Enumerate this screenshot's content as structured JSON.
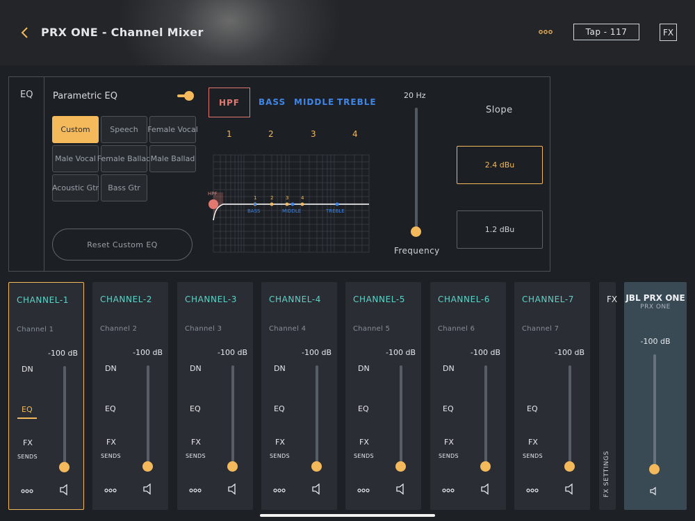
{
  "header": {
    "title": "PRX ONE - Channel Mixer",
    "tap_label": "Tap - 117",
    "fx_label": "FX"
  },
  "eq": {
    "side_label": "EQ",
    "title": "Parametric EQ",
    "toggle_on": true,
    "presets": [
      "Custom",
      "Speech",
      "Female Vocal",
      "Male Vocal",
      "Female Ballad",
      "Male Ballad",
      "Acoustic Gtr",
      "Bass Gtr"
    ],
    "active_preset": "Custom",
    "reset_label": "Reset Custom EQ",
    "tabs": {
      "hpf": "HPF",
      "bass": "BASS",
      "middle": "MIDDLE",
      "treble": "TREBLE"
    },
    "band_numbers": [
      "1",
      "2",
      "3",
      "4"
    ],
    "graph": {
      "hpf_label": "HPF",
      "point_numbers": [
        "1",
        "2",
        "3",
        "4"
      ],
      "bass_label": "BASS",
      "middle_label": "MIDDLE",
      "treble_label": "TREBLE"
    },
    "frequency_value": "20 Hz",
    "frequency_label": "Frequency",
    "slope_label": "Slope",
    "slope_options": [
      "2.4 dBu",
      "1.2 dBu"
    ],
    "slope_selected": "2.4 dBu",
    "colors": {
      "accent": "#f4b95a",
      "hpf": "#e2786f",
      "band": "#3f86e8",
      "channel_name": "#5fd3c7"
    }
  },
  "channels": [
    {
      "name": "CHANNEL-1",
      "subtitle": "Channel 1",
      "level": "-100 dB",
      "dn": "DN",
      "eq": "EQ",
      "fx": "FX",
      "sends": "SENDS"
    },
    {
      "name": "CHANNEL-2",
      "subtitle": "Channel 2",
      "level": "-100 dB",
      "dn": "DN",
      "eq": "EQ",
      "fx": "FX",
      "sends": "SENDS"
    },
    {
      "name": "CHANNEL-3",
      "subtitle": "Channel 3",
      "level": "-100 dB",
      "dn": "DN",
      "eq": "EQ",
      "fx": "FX",
      "sends": "SENDS"
    },
    {
      "name": "CHANNEL-4",
      "subtitle": "Channel 4",
      "level": "-100 dB",
      "dn": "DN",
      "eq": "EQ",
      "fx": "FX",
      "sends": "SENDS"
    },
    {
      "name": "CHANNEL-5",
      "subtitle": "Channel 5",
      "level": "-100 dB",
      "dn": "DN",
      "eq": "EQ",
      "fx": "FX",
      "sends": "SENDS"
    },
    {
      "name": "CHANNEL-6",
      "subtitle": "Channel 6",
      "level": "-100 dB",
      "dn": "DN",
      "eq": "EQ",
      "fx": "FX",
      "sends": "SENDS"
    },
    {
      "name": "CHANNEL-7",
      "subtitle": "Channel 7",
      "level": "-100 dB",
      "dn": "",
      "eq": "EQ",
      "fx": "FX",
      "sends": "SENDS"
    }
  ],
  "selected_channel": "CHANNEL-1",
  "fx_strip": {
    "label": "FX",
    "settings_label": "FX SETTINGS"
  },
  "master": {
    "title": "JBL PRX ONE",
    "subtitle": "PRX ONE",
    "level": "-100 dB"
  }
}
